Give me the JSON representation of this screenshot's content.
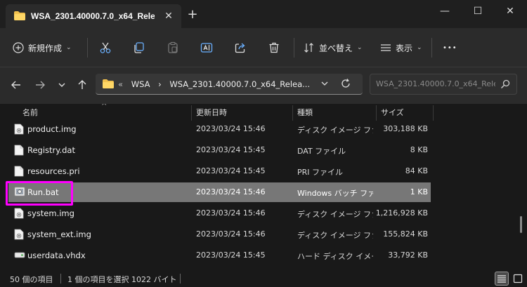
{
  "window": {
    "tab_title": "WSA_2301.40000.7.0_x64_Rele",
    "tab_close": "✕",
    "new_tab": "+",
    "minimize": "—",
    "maximize": "☐",
    "close": "✕"
  },
  "toolbar": {
    "new_label": "新規作成",
    "sort_label": "並べ替え",
    "view_label": "表示",
    "more_label": "•••"
  },
  "address": {
    "overflow": "«",
    "crumbs": [
      "WSA",
      "›",
      "WSA_2301.40000.7.0_x64_Relea..."
    ],
    "search_placeholder": "WSA_2301.40000.7.0_x64_Rele..."
  },
  "columns": {
    "name": "名前",
    "date": "更新日時",
    "type": "種類",
    "size": "サイズ"
  },
  "files": [
    {
      "name": "product.img",
      "date": "2023/03/24 15:46",
      "type": "ディスク イメージ ファ...",
      "size": "303,188 KB",
      "icon": "disc-image-icon",
      "selected": false
    },
    {
      "name": "Registry.dat",
      "date": "2023/03/24 15:45",
      "type": "DAT ファイル",
      "size": "8 KB",
      "icon": "file-icon",
      "selected": false
    },
    {
      "name": "resources.pri",
      "date": "2023/03/24 15:45",
      "type": "PRI ファイル",
      "size": "84 KB",
      "icon": "file-icon",
      "selected": false
    },
    {
      "name": "Run.bat",
      "date": "2023/03/24 15:46",
      "type": "Windows バッチ ファ...",
      "size": "1 KB",
      "icon": "batch-file-icon",
      "selected": true
    },
    {
      "name": "system.img",
      "date": "2023/03/24 15:46",
      "type": "ディスク イメージ ファ...",
      "size": "1,216,928 KB",
      "icon": "disc-image-icon",
      "selected": false
    },
    {
      "name": "system_ext.img",
      "date": "2023/03/24 15:46",
      "type": "ディスク イメージ ファ...",
      "size": "155,824 KB",
      "icon": "disc-image-icon",
      "selected": false
    },
    {
      "name": "userdata.vhdx",
      "date": "2023/03/24 15:45",
      "type": "ハード ディスク イメー...",
      "size": "33,792 KB",
      "icon": "vhd-icon",
      "selected": false
    }
  ],
  "status": {
    "count": "50 個の項目",
    "selection": "1 個の項目を選択  1022 バイト"
  },
  "colors": {
    "highlight": "#ff00ff",
    "selected_row": "#777777"
  }
}
